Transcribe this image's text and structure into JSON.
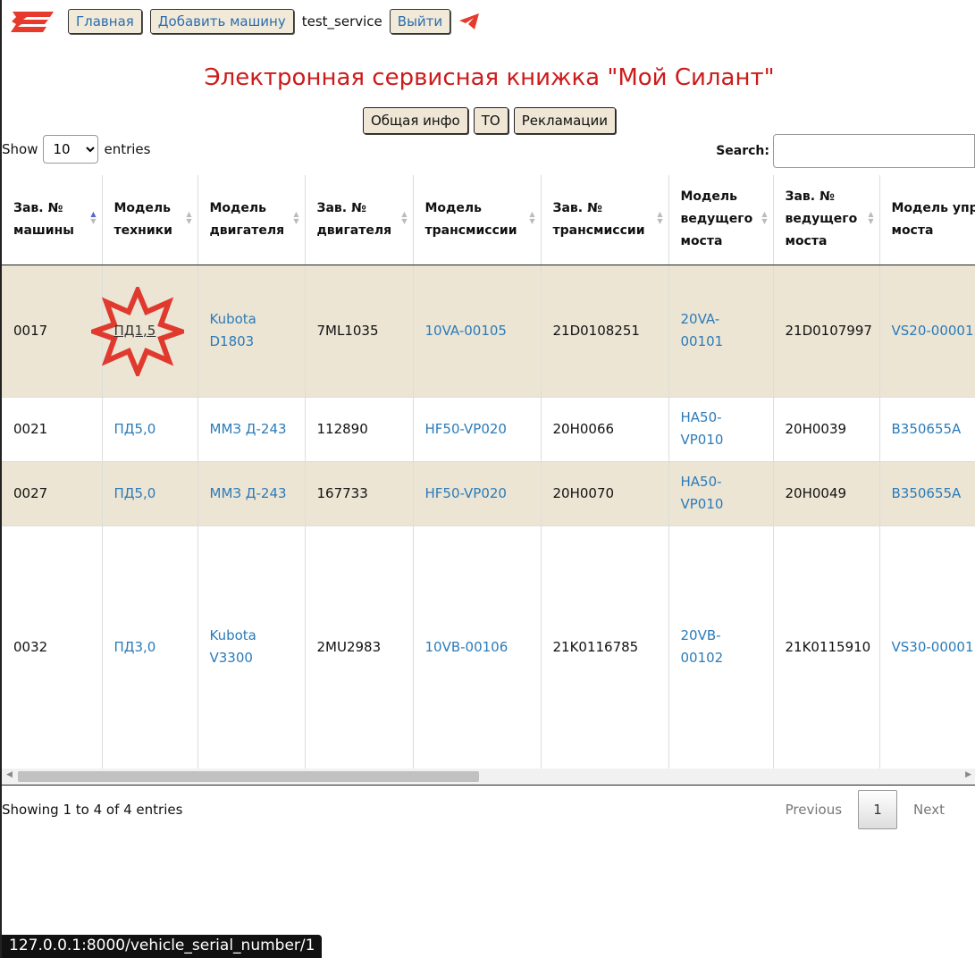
{
  "nav": {
    "home": "Главная",
    "add_vehicle": "Добавить машину",
    "username": "test_service",
    "logout": "Выйти"
  },
  "page_title": "Электронная сервисная книжка \"Мой Силант\"",
  "tabs": [
    "Общая инфо",
    "ТО",
    "Рекламации"
  ],
  "length": {
    "show": "Show",
    "value": "10",
    "entries": "entries"
  },
  "search": {
    "label": "Search:",
    "value": ""
  },
  "table": {
    "headers": [
      "Зав. № машины",
      "Модель техники",
      "Модель двигателя",
      "Зав. № двигателя",
      "Модель трансмиссии",
      "Зав. № трансмиссии",
      "Модель ведущего моста",
      "Зав. № ведущего моста",
      "Модель управляемого моста"
    ],
    "rows": [
      [
        "0017",
        "ПД1,5",
        "Kubota D1803",
        "7ML1035",
        "10VA-00105",
        "21D0108251",
        "20VA-00101",
        "21D0107997",
        "VS20-00001"
      ],
      [
        "0021",
        "ПД5,0",
        "ММЗ Д-243",
        "112890",
        "HF50-VP020",
        "20H0066",
        "HA50-VP010",
        "20H0039",
        "B350655A"
      ],
      [
        "0027",
        "ПД5,0",
        "ММЗ Д-243",
        "167733",
        "HF50-VP020",
        "20H0070",
        "HA50-VP010",
        "20H0049",
        "B350655A"
      ],
      [
        "0032",
        "ПД3,0",
        "Kubota V3300",
        "2MU2983",
        "10VB-00106",
        "21K0116785",
        "20VB-00102",
        "21K0115910",
        "VS30-00001"
      ]
    ]
  },
  "info": "Showing 1 to 4 of 4 entries",
  "pagination": {
    "previous": "Previous",
    "page": "1",
    "next": "Next"
  },
  "status_url": "127.0.0.1:8000/vehicle_serial_number/1",
  "colors": {
    "title": "#cc1b1b",
    "link": "#2b7bb9",
    "odd_row": "#ece5d4",
    "burst": "#e03a2f"
  }
}
